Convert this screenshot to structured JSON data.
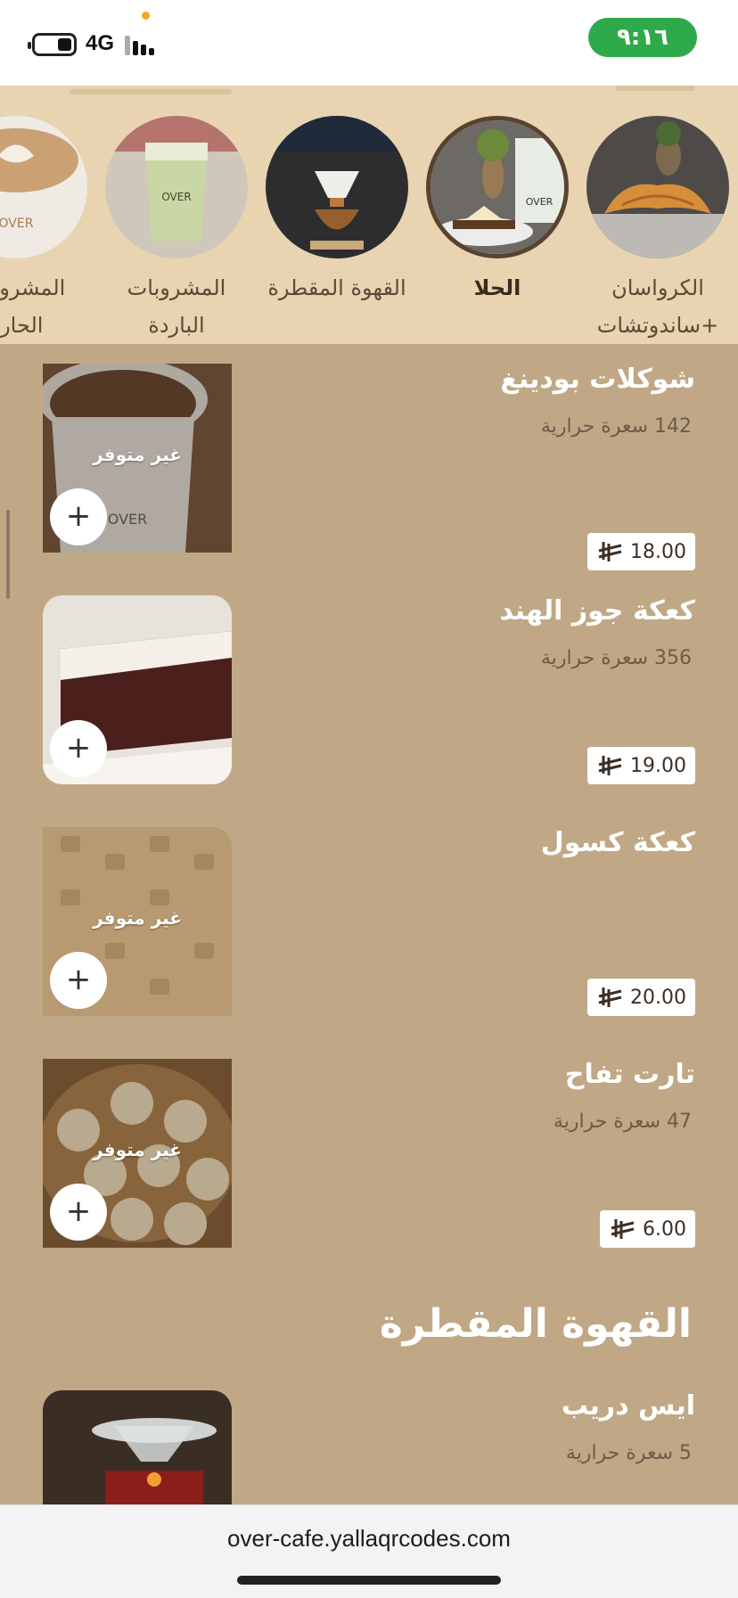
{
  "status": {
    "time": "٩:١٦",
    "network": "4G"
  },
  "categories": [
    {
      "label": "الكرواسان +ساندوتشات",
      "active": false
    },
    {
      "label": "الحلا",
      "active": true
    },
    {
      "label": "القهوة المقطرة",
      "active": false
    },
    {
      "label": "المشروبات الباردة",
      "active": false
    },
    {
      "label": "المشروبات الحارة",
      "active": false
    }
  ],
  "unavailable_label": "غير متوفر",
  "add_symbol": "+",
  "items": [
    {
      "name": "شوكلات بودينغ",
      "calories": "142 سعرة حرارية",
      "price": "18.00",
      "unavailable": true
    },
    {
      "name": "كعكة جوز الهند",
      "calories": "356 سعرة حرارية",
      "price": "19.00",
      "unavailable": false
    },
    {
      "name": "كعكة كسول",
      "calories": "",
      "price": "20.00",
      "unavailable": true
    },
    {
      "name": "تارت تفاح",
      "calories": "47 سعرة حرارية",
      "price": "6.00",
      "unavailable": true
    }
  ],
  "section": {
    "title": "القهوة المقطرة",
    "first_item": {
      "name": "ايس دريب",
      "calories": "5 سعرة حرارية"
    }
  },
  "browser": {
    "url": "over-cafe.yallaqrcodes.com"
  },
  "colors": {
    "accent_green": "#2eaa4a",
    "background": "#c0a886",
    "category_bar": "#e8d4b1"
  }
}
